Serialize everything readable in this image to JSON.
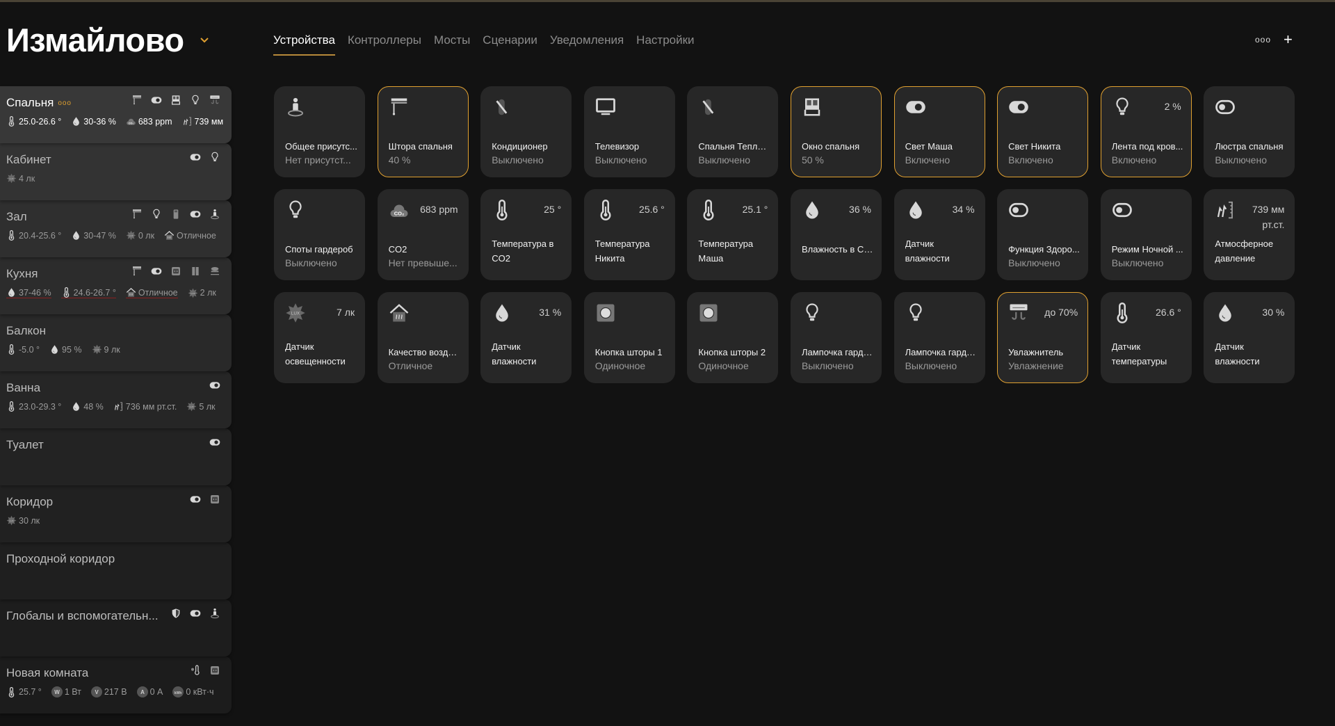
{
  "header": {
    "title": "Измайлово",
    "more": "ооо",
    "add": "+",
    "tabs": [
      {
        "label": "Устройства",
        "active": true
      },
      {
        "label": "Контроллеры"
      },
      {
        "label": "Мосты"
      },
      {
        "label": "Сценарии"
      },
      {
        "label": "Уведомления"
      },
      {
        "label": "Настройки"
      }
    ]
  },
  "colors": {
    "accent": "#e0a030",
    "card": "#272727",
    "bg": "#121212"
  },
  "rooms": [
    {
      "name": "Спальня",
      "selected": true,
      "dots": "ооо",
      "bg": "#383838",
      "icons": [
        "curtain-icon",
        "toggle-on-icon",
        "window-icon",
        "bulb-icon",
        "humidifier-icon"
      ],
      "stats": [
        {
          "icon": "thermometer-icon",
          "text": "25.0-26.6 °"
        },
        {
          "icon": "drop-icon",
          "text": "30-36 %"
        },
        {
          "icon": "co2-icon",
          "text": "683 ppm"
        },
        {
          "icon": "pressure-icon",
          "text": "739 мм"
        }
      ]
    },
    {
      "name": "Кабинет",
      "bg": "#333333",
      "icons": [
        "toggle-on-icon",
        "bulb-icon"
      ],
      "stats": [
        {
          "icon": "lux-icon",
          "text": "4 лк"
        }
      ]
    },
    {
      "name": "Зал",
      "bg": "#2f2f2f",
      "icons": [
        "curtain-icon",
        "bulb-icon",
        "device-icon",
        "toggle-on-icon",
        "person-icon"
      ],
      "stats": [
        {
          "icon": "thermometer-icon",
          "text": "20.4-25.6 °"
        },
        {
          "icon": "drop-icon",
          "text": "30-47 %"
        },
        {
          "icon": "lux-icon",
          "text": "0 лк"
        },
        {
          "icon": "air-quality-icon",
          "text": "Отличное"
        }
      ]
    },
    {
      "name": "Кухня",
      "bg": "#2c2c2c",
      "icons": [
        "curtain-icon",
        "toggle-on-icon",
        "socket-icon",
        "door-icon",
        "smoke-icon"
      ],
      "stats": [
        {
          "icon": "drop-icon",
          "text": "37-46 %",
          "warn": true
        },
        {
          "icon": "thermometer-icon",
          "text": "24.6-26.7 °",
          "warn": true
        },
        {
          "icon": "air-quality-icon",
          "text": "Отличное",
          "warn": true
        },
        {
          "icon": "lux-icon",
          "text": "2 лк"
        }
      ]
    },
    {
      "name": "Балкон",
      "bg": "#292929",
      "icons": [],
      "stats": [
        {
          "icon": "thermometer-icon",
          "text": "-5.0 °"
        },
        {
          "icon": "drop-icon",
          "text": "95 %"
        },
        {
          "icon": "lux-icon",
          "text": "9 лк"
        }
      ]
    },
    {
      "name": "Ванна",
      "bg": "#262626",
      "icons": [
        "toggle-on-icon"
      ],
      "stats": [
        {
          "icon": "thermometer-icon",
          "text": "23.0-29.3 °"
        },
        {
          "icon": "drop-icon",
          "text": "48 %"
        },
        {
          "icon": "pressure-icon",
          "text": "736 мм рт.ст."
        },
        {
          "icon": "lux-icon",
          "text": "5 лк"
        }
      ]
    },
    {
      "name": "Туалет",
      "bg": "#232323",
      "icons": [
        "toggle-on-icon"
      ],
      "stats": []
    },
    {
      "name": "Коридор",
      "bg": "#212121",
      "icons": [
        "toggle-on-icon",
        "socket-icon"
      ],
      "stats": [
        {
          "icon": "lux-icon",
          "text": "30 лк"
        }
      ]
    },
    {
      "name": "Проходной коридор",
      "bg": "#1f1f1f",
      "icons": [],
      "stats": []
    },
    {
      "name": "Глобалы и вспомогательн...",
      "bg": "#1d1d1d",
      "icons": [
        "shield-icon",
        "toggle-on-icon",
        "person-icon"
      ],
      "stats": []
    },
    {
      "name": "Новая комната",
      "bg": "#1c1c1c",
      "icons": [
        "thermostat-icon",
        "socket-icon"
      ],
      "stats": [
        {
          "icon": "thermometer-icon",
          "text": "25.7 °"
        },
        {
          "icon": "watt-badge-icon",
          "badge": "W",
          "text": "1 Вт"
        },
        {
          "icon": "volt-badge-icon",
          "badge": "V",
          "text": "217 В"
        },
        {
          "icon": "amp-badge-icon",
          "badge": "A",
          "text": "0 А"
        },
        {
          "icon": "kwh-badge-icon",
          "badge": "kWh",
          "text": "0 кВт·ч"
        }
      ]
    }
  ],
  "devices": [
    {
      "icon": "person-icon",
      "name": "Общее присутс...",
      "state": "Нет присутст..."
    },
    {
      "icon": "curtain-icon",
      "name": "Штора спальня",
      "state": "40 %",
      "on": true
    },
    {
      "icon": "ac-off-icon",
      "name": "Кондиционер",
      "state": "Выключено"
    },
    {
      "icon": "tv-icon",
      "name": "Телевизор",
      "state": "Выключено"
    },
    {
      "icon": "ac-off-icon",
      "name": "Спальня Теплый...",
      "state": "Выключено"
    },
    {
      "icon": "window-icon",
      "name": "Окно спальня",
      "state": "50 %",
      "on": true
    },
    {
      "icon": "toggle-on-icon",
      "name": "Свет Маша",
      "state": "Включено",
      "on": true
    },
    {
      "icon": "toggle-on-icon",
      "name": "Свет Никита",
      "state": "Включено",
      "on": true
    },
    {
      "icon": "bulb-icon",
      "name": "Лента под кров...",
      "state": "Включено",
      "value": "2 %",
      "on": true
    },
    {
      "icon": "toggle-off-icon",
      "name": "Люстра спальня",
      "state": "Выключено"
    },
    {
      "icon": "bulb-icon",
      "name": "Споты гардероб",
      "state": "Выключено"
    },
    {
      "icon": "co2-icon",
      "name": "CO2",
      "state": "Нет превыше...",
      "value": "683 ppm"
    },
    {
      "icon": "thermometer-icon",
      "name": "Температура в CO2",
      "value": "25 °",
      "two": true
    },
    {
      "icon": "thermometer-icon",
      "name": "Температура Никита",
      "value": "25.6 °",
      "two": true
    },
    {
      "icon": "thermometer-icon",
      "name": "Температура Маша",
      "value": "25.1 °",
      "two": true
    },
    {
      "icon": "drop-icon",
      "name": "Влажность в CO2",
      "value": "36 %"
    },
    {
      "icon": "drop-icon",
      "name": "Датчик влажности",
      "value": "34 %",
      "two": true
    },
    {
      "icon": "toggle-off-icon",
      "name": "Функция Здоро...",
      "state": "Выключено"
    },
    {
      "icon": "toggle-off-icon",
      "name": "Режим Ночной ...",
      "state": "Выключено"
    },
    {
      "icon": "pressure-icon",
      "name": "Атмосферное давление",
      "value": "739 мм рт.ст.",
      "two": true
    },
    {
      "icon": "lux-icon",
      "name": "Датчик освещенности",
      "value": "7 лк",
      "two": true
    },
    {
      "icon": "air-quality-icon",
      "name": "Качество воздуха",
      "state": "Отличное"
    },
    {
      "icon": "drop-icon",
      "name": "Датчик влажности",
      "value": "31 %",
      "two": true
    },
    {
      "icon": "button-icon",
      "name": "Кнопка шторы 1",
      "state": "Одиночное"
    },
    {
      "icon": "button-icon",
      "name": "Кнопка шторы 2",
      "state": "Одиночное"
    },
    {
      "icon": "bulb-icon",
      "name": "Лампочка гарде...",
      "state": "Выключено"
    },
    {
      "icon": "bulb-icon",
      "name": "Лампочка гарде...",
      "state": "Выключено"
    },
    {
      "icon": "humidifier-icon",
      "name": "Увлажнитель",
      "state": "Увлажнение",
      "value": "до 70%",
      "on": true
    },
    {
      "icon": "thermometer-icon",
      "name": "Датчик температуры",
      "value": "26.6 °",
      "two": true
    },
    {
      "icon": "drop-icon",
      "name": "Датчик влажности",
      "value": "30 %",
      "two": true
    }
  ]
}
